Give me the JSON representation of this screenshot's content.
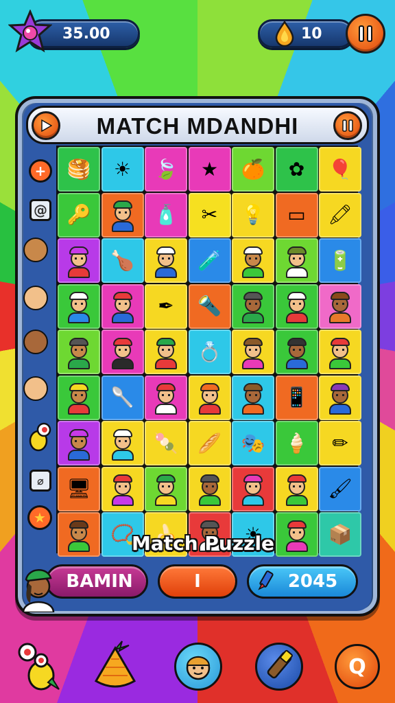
{
  "hud": {
    "coins": "35.00",
    "drops": "10"
  },
  "panel": {
    "title": "MATCH MDANDHI",
    "match_label": "Match Puzzle"
  },
  "bottom_bar": {
    "player_name": "BAMIN",
    "middle_value": "I",
    "score": "2045"
  },
  "colors": {
    "accent_orange": "#ff6a28",
    "panel_blue": "#2f5aa8",
    "name_pill": "#b0287e",
    "score_pill": "#2aa8e8"
  },
  "grid": {
    "rows": [
      [
        {
          "bg": "#2ec24a",
          "kind": "icon",
          "icon": "pancakes-icon"
        },
        {
          "bg": "#2ec8e8",
          "kind": "icon",
          "icon": "sun-icon"
        },
        {
          "bg": "#e83ab8",
          "kind": "icon",
          "icon": "leaf-icon"
        },
        {
          "bg": "#e83ab8",
          "kind": "icon",
          "icon": "star-icon"
        },
        {
          "bg": "#6ed832",
          "kind": "icon",
          "icon": "orange-fruit-icon"
        },
        {
          "bg": "#2ec24a",
          "kind": "icon",
          "icon": "flower-icon"
        },
        {
          "bg": "#f6d822",
          "kind": "icon",
          "icon": "balloon-icon"
        }
      ],
      [
        {
          "bg": "#3ac83a",
          "kind": "icon",
          "icon": "key-icon"
        },
        {
          "bg": "#f06a22",
          "kind": "char",
          "skin": "#f2c08a",
          "hat": "#2aa84a",
          "shirt": "#2a6ad8"
        },
        {
          "bg": "#e83ab8",
          "kind": "icon",
          "icon": "bottle-icon"
        },
        {
          "bg": "#f6e020",
          "kind": "icon",
          "icon": "scissors-icon"
        },
        {
          "bg": "#f6d822",
          "kind": "icon",
          "icon": "lamp-icon"
        },
        {
          "bg": "#f06a22",
          "kind": "icon",
          "icon": "tablet-icon"
        },
        {
          "bg": "#f6d822",
          "kind": "icon",
          "icon": "marker-icon"
        }
      ],
      [
        {
          "bg": "#b83ae8",
          "kind": "char",
          "skin": "#f2c08a",
          "hat": "#c83ae8",
          "shirt": "#e83a3a"
        },
        {
          "bg": "#2ec8e8",
          "kind": "icon",
          "icon": "chicken-icon"
        },
        {
          "bg": "#f6d822",
          "kind": "char",
          "skin": "#f2c08a",
          "hat": "#ffffff",
          "shirt": "#2a6ad8"
        },
        {
          "bg": "#2a8ae8",
          "kind": "icon",
          "icon": "tube-icon"
        },
        {
          "bg": "#f6d822",
          "kind": "char",
          "skin": "#c8884a",
          "hat": "#ffffff",
          "shirt": "#3ac83a"
        },
        {
          "bg": "#6ed832",
          "kind": "char",
          "skin": "#f2c08a",
          "hat": "#6a8a2a",
          "shirt": "#ffffff"
        },
        {
          "bg": "#2a8ae8",
          "kind": "icon",
          "icon": "battery-icon"
        }
      ],
      [
        {
          "bg": "#3ac83a",
          "kind": "char",
          "skin": "#f2c08a",
          "hat": "#ffffff",
          "shirt": "#2a8ae8"
        },
        {
          "bg": "#e83ab8",
          "kind": "char",
          "skin": "#f2c08a",
          "hat": "#e83a3a",
          "shirt": "#2a6ad8"
        },
        {
          "bg": "#f6d822",
          "kind": "icon",
          "icon": "pen-icon"
        },
        {
          "bg": "#f06a22",
          "kind": "icon",
          "icon": "flashlight-icon"
        },
        {
          "bg": "#3ac83a",
          "kind": "char",
          "skin": "#a8683a",
          "hat": "#555555",
          "shirt": "#2aa84a"
        },
        {
          "bg": "#3ac83a",
          "kind": "char",
          "skin": "#f2c08a",
          "hat": "#ffffff",
          "shirt": "#e83a3a"
        },
        {
          "bg": "#f06ac8",
          "kind": "char",
          "skin": "#a8683a",
          "hat": "#8a4a1a",
          "shirt": "#e87a2a"
        }
      ],
      [
        {
          "bg": "#6ed832",
          "kind": "char",
          "skin": "#c8884a",
          "hat": "#555555",
          "shirt": "#2aa84a"
        },
        {
          "bg": "#e83ab8",
          "kind": "char",
          "skin": "#f2c08a",
          "hat": "#e83a3a",
          "shirt": "#2a2a2a"
        },
        {
          "bg": "#f6d822",
          "kind": "char",
          "skin": "#f2c08a",
          "hat": "#2aa84a",
          "shirt": "#e83a3a"
        },
        {
          "bg": "#2ec8e8",
          "kind": "icon",
          "icon": "ring-icon"
        },
        {
          "bg": "#f6d822",
          "kind": "char",
          "skin": "#f2c08a",
          "hat": "#8a5a2a",
          "shirt": "#e83ab8"
        },
        {
          "bg": "#3ac83a",
          "kind": "char",
          "skin": "#a8683a",
          "hat": "#333333",
          "shirt": "#2a6ad8"
        },
        {
          "bg": "#f6d822",
          "kind": "char",
          "skin": "#f2c08a",
          "hat": "#e83a3a",
          "shirt": "#3ac83a"
        }
      ],
      [
        {
          "bg": "#3ac83a",
          "kind": "char",
          "skin": "#c8884a",
          "hat": "#f6d822",
          "shirt": "#e83a3a"
        },
        {
          "bg": "#2a8ae8",
          "kind": "icon",
          "icon": "spoon-icon"
        },
        {
          "bg": "#e83ab8",
          "kind": "char",
          "skin": "#f2c08a",
          "hat": "#e83a3a",
          "shirt": "#ffffff"
        },
        {
          "bg": "#f6d822",
          "kind": "char",
          "skin": "#f2c08a",
          "hat": "#f06a22",
          "shirt": "#e83a3a"
        },
        {
          "bg": "#2ec8e8",
          "kind": "char",
          "skin": "#a8683a",
          "hat": "#8a5a2a",
          "shirt": "#f06a22"
        },
        {
          "bg": "#f06a22",
          "kind": "icon",
          "icon": "phone-icon"
        },
        {
          "bg": "#f6d822",
          "kind": "char",
          "skin": "#a8683a",
          "hat": "#8a3ab8",
          "shirt": "#2a6ad8"
        }
      ],
      [
        {
          "bg": "#b83ae8",
          "kind": "char",
          "skin": "#c8884a",
          "hat": "#c83ae8",
          "shirt": "#2a6ad8"
        },
        {
          "bg": "#f6d822",
          "kind": "char",
          "skin": "#f2c08a",
          "hat": "#ffffff",
          "shirt": "#2ec8e8"
        },
        {
          "bg": "#f6d822",
          "kind": "icon",
          "icon": "popsicle-icon"
        },
        {
          "bg": "#f6d822",
          "kind": "icon",
          "icon": "bread-icon"
        },
        {
          "bg": "#2ec8e8",
          "kind": "icon",
          "icon": "mask-icon"
        },
        {
          "bg": "#3ac83a",
          "kind": "icon",
          "icon": "cone-icon"
        },
        {
          "bg": "#f6d822",
          "kind": "icon",
          "icon": "pencil-icon"
        }
      ],
      [
        {
          "bg": "#f06a22",
          "kind": "icon",
          "icon": "screen-icon"
        },
        {
          "bg": "#f6d822",
          "kind": "char",
          "skin": "#f2c08a",
          "hat": "#e83a3a",
          "shirt": "#c83ae8"
        },
        {
          "bg": "#6ed832",
          "kind": "char",
          "skin": "#f2c08a",
          "hat": "#2aa84a",
          "shirt": "#f6d822"
        },
        {
          "bg": "#f6d822",
          "kind": "char",
          "skin": "#a8683a",
          "hat": "#555555",
          "shirt": "#3ac83a"
        },
        {
          "bg": "#e83a3a",
          "kind": "char",
          "skin": "#f2c08a",
          "hat": "#e83ab8",
          "shirt": "#2ec8e8"
        },
        {
          "bg": "#f6d822",
          "kind": "char",
          "skin": "#f2c08a",
          "hat": "#e83a3a",
          "shirt": "#3ac83a"
        },
        {
          "bg": "#2a8ae8",
          "kind": "icon",
          "icon": "brush-icon"
        }
      ],
      [
        {
          "bg": "#f06a22",
          "kind": "char",
          "skin": "#c8884a",
          "hat": "#6a3a1a",
          "shirt": "#3ac83a"
        },
        {
          "bg": "#2ec8e8",
          "kind": "icon",
          "icon": "bracelet-icon"
        },
        {
          "bg": "#f6d822",
          "kind": "icon",
          "icon": "banana-icon"
        },
        {
          "bg": "#e83a3a",
          "kind": "char",
          "skin": "#a8683a",
          "hat": "#555555",
          "shirt": "#ffffff"
        },
        {
          "bg": "#2ec8e8",
          "kind": "icon",
          "icon": "sun-icon"
        },
        {
          "bg": "#3ac83a",
          "kind": "char",
          "skin": "#f2c08a",
          "hat": "#e83a3a",
          "shirt": "#e83ab8"
        },
        {
          "bg": "#2ec8a8",
          "kind": "icon",
          "icon": "box-icon"
        }
      ]
    ]
  }
}
